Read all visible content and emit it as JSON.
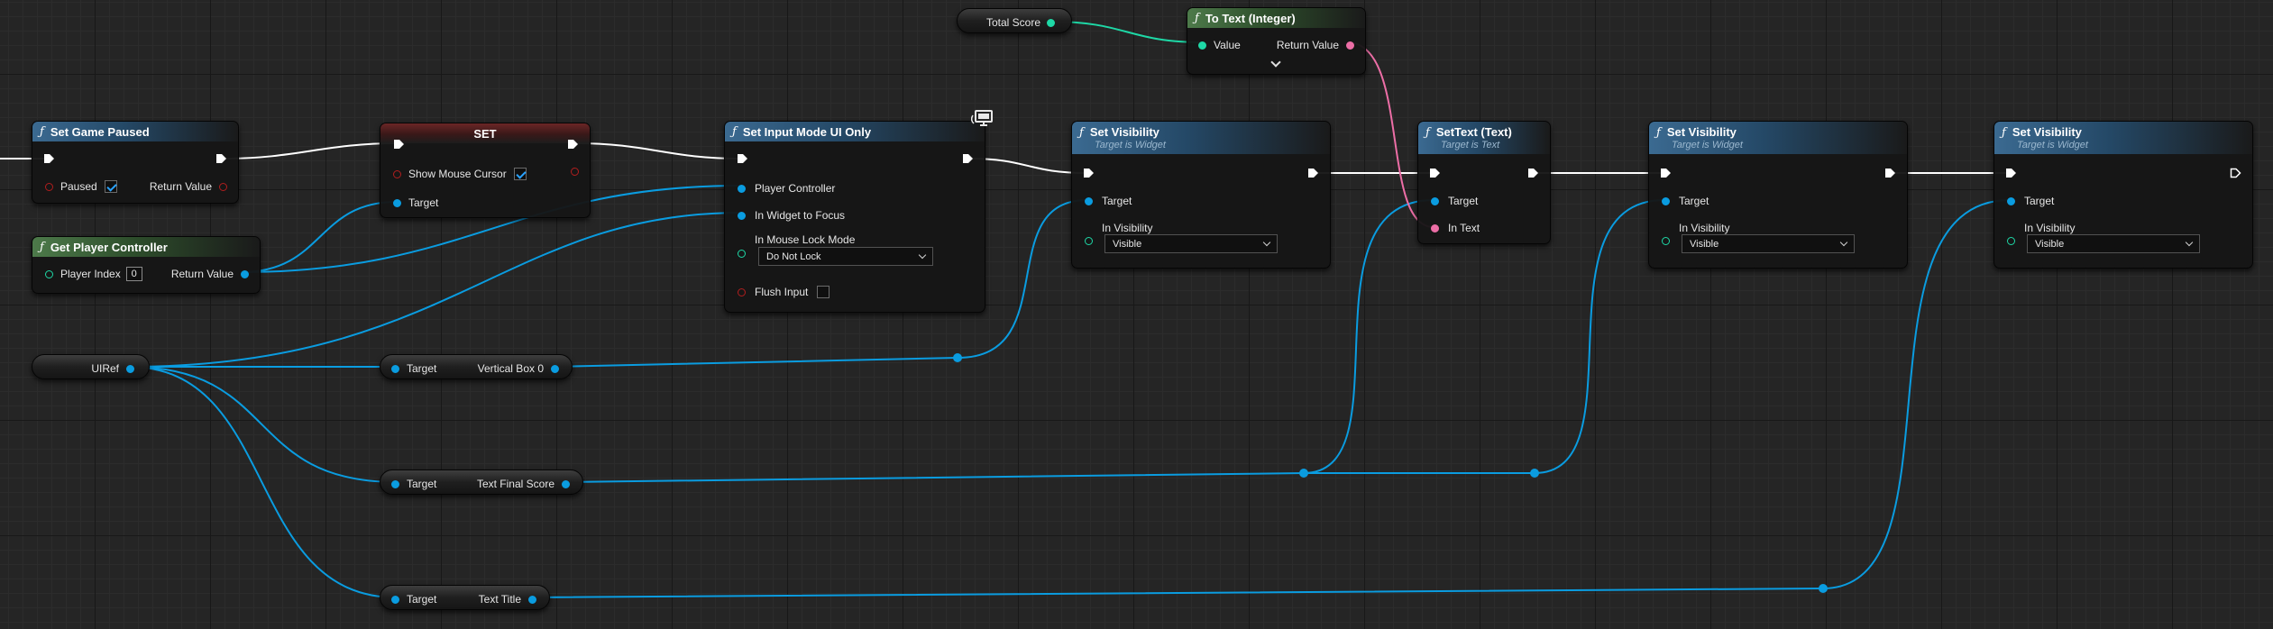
{
  "colors": {
    "exec_wire": "#ffffff",
    "object_wire": "#0a9ce0",
    "integer_wire": "#1ed8a6",
    "text_wire": "#ec6ea6",
    "bool_pin": "#b01e1e",
    "function_header": "#3b6a91",
    "pure_header": "#4d7a4a",
    "set_header": "#6b2626"
  },
  "nodes": {
    "total_score": {
      "label": "Total Score"
    },
    "to_text": {
      "title": "To Text (Integer)",
      "value_label": "Value",
      "return_label": "Return Value"
    },
    "set_game_paused": {
      "title": "Set Game Paused",
      "paused_label": "Paused",
      "paused_checked": true,
      "return_label": "Return Value"
    },
    "set_show_cursor": {
      "title": "SET",
      "show_cursor_label": "Show Mouse Cursor",
      "checked": true,
      "target_label": "Target"
    },
    "get_player_controller": {
      "title": "Get Player Controller",
      "player_index_label": "Player Index",
      "player_index_value": "0",
      "return_label": "Return Value"
    },
    "set_input_mode": {
      "title": "Set Input Mode UI Only",
      "player_controller_label": "Player Controller",
      "widget_focus_label": "In Widget to Focus",
      "mouse_lock_label": "In Mouse Lock Mode",
      "mouse_lock_value": "Do Not Lock",
      "flush_label": "Flush Input"
    },
    "set_visibility_1": {
      "title": "Set Visibility",
      "subtitle": "Target is Widget",
      "target_label": "Target",
      "visibility_label": "In Visibility",
      "visibility_value": "Visible"
    },
    "set_text": {
      "title": "SetText (Text)",
      "subtitle": "Target is Text",
      "target_label": "Target",
      "in_text_label": "In Text"
    },
    "set_visibility_2": {
      "title": "Set Visibility",
      "subtitle": "Target is Widget",
      "target_label": "Target",
      "visibility_label": "In Visibility",
      "visibility_value": "Visible"
    },
    "set_visibility_3": {
      "title": "Set Visibility",
      "subtitle": "Target is Widget",
      "target_label": "Target",
      "visibility_label": "In Visibility",
      "visibility_value": "Visible"
    },
    "uiref": {
      "label": "UIRef"
    },
    "get_vertical_box": {
      "target_label": "Target",
      "output_label": "Vertical Box 0"
    },
    "get_text_final_score": {
      "target_label": "Target",
      "output_label": "Text Final Score"
    },
    "get_text_title": {
      "target_label": "Target",
      "output_label": "Text Title"
    }
  },
  "icons": [
    "function-icon",
    "exec-pin-icon",
    "object-pin-icon",
    "checkbox-icon",
    "dropdown-caret-icon",
    "expand-chevron-icon",
    "desktop-only-icon"
  ]
}
